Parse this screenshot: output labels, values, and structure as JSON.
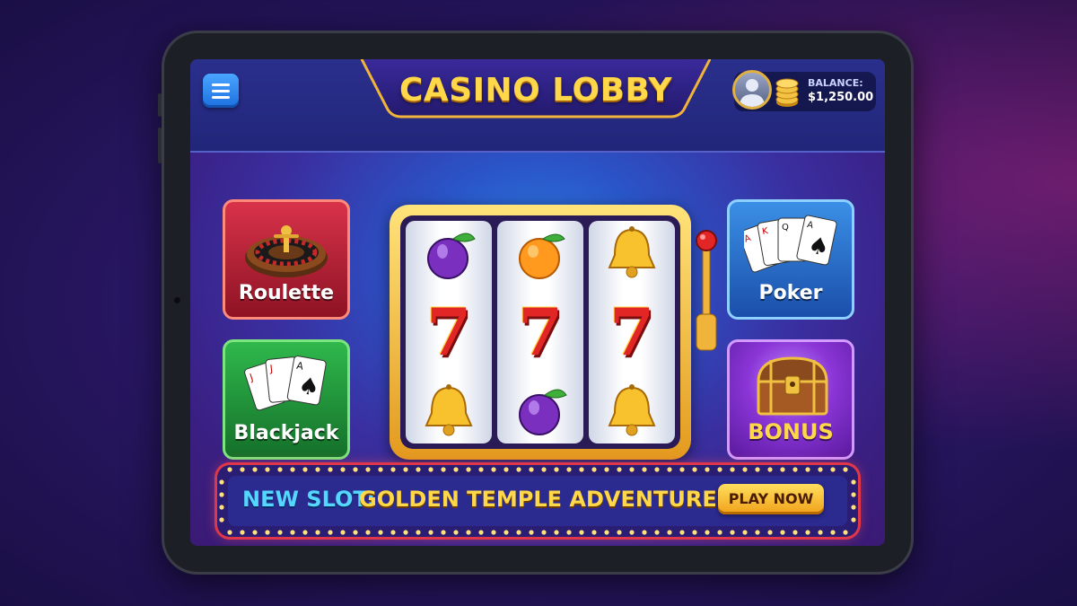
{
  "header": {
    "title": "CASINO LOBBY",
    "menu_icon": "hamburger-menu-icon",
    "balance_label": "BALANCE:",
    "balance_value": "$1,250.00"
  },
  "games": [
    {
      "label": "Roulette",
      "icon": "roulette-wheel-icon",
      "color": "#c8283a"
    },
    {
      "label": "Blackjack",
      "icon": "playing-cards-icon",
      "color": "#27a844"
    },
    {
      "label": "Poker",
      "icon": "playing-cards-icon",
      "color": "#2a8be0"
    },
    {
      "label": "BONUS",
      "icon": "treasure-chest-icon",
      "color": "#9b3fe0"
    }
  ],
  "slot_machine": {
    "reels": [
      [
        "plum",
        "7",
        "bell"
      ],
      [
        "orange",
        "7",
        "plum"
      ],
      [
        "bell",
        "7",
        "bell"
      ]
    ]
  },
  "promo": {
    "prefix": "NEW SLOT:",
    "text": "GOLDEN TEMPLE ADVENTURE!",
    "button": "PLAY NOW"
  },
  "colors": {
    "gold": "#ffd84a",
    "accent_blue": "#55d6ff",
    "marquee_red": "#e0364a"
  }
}
